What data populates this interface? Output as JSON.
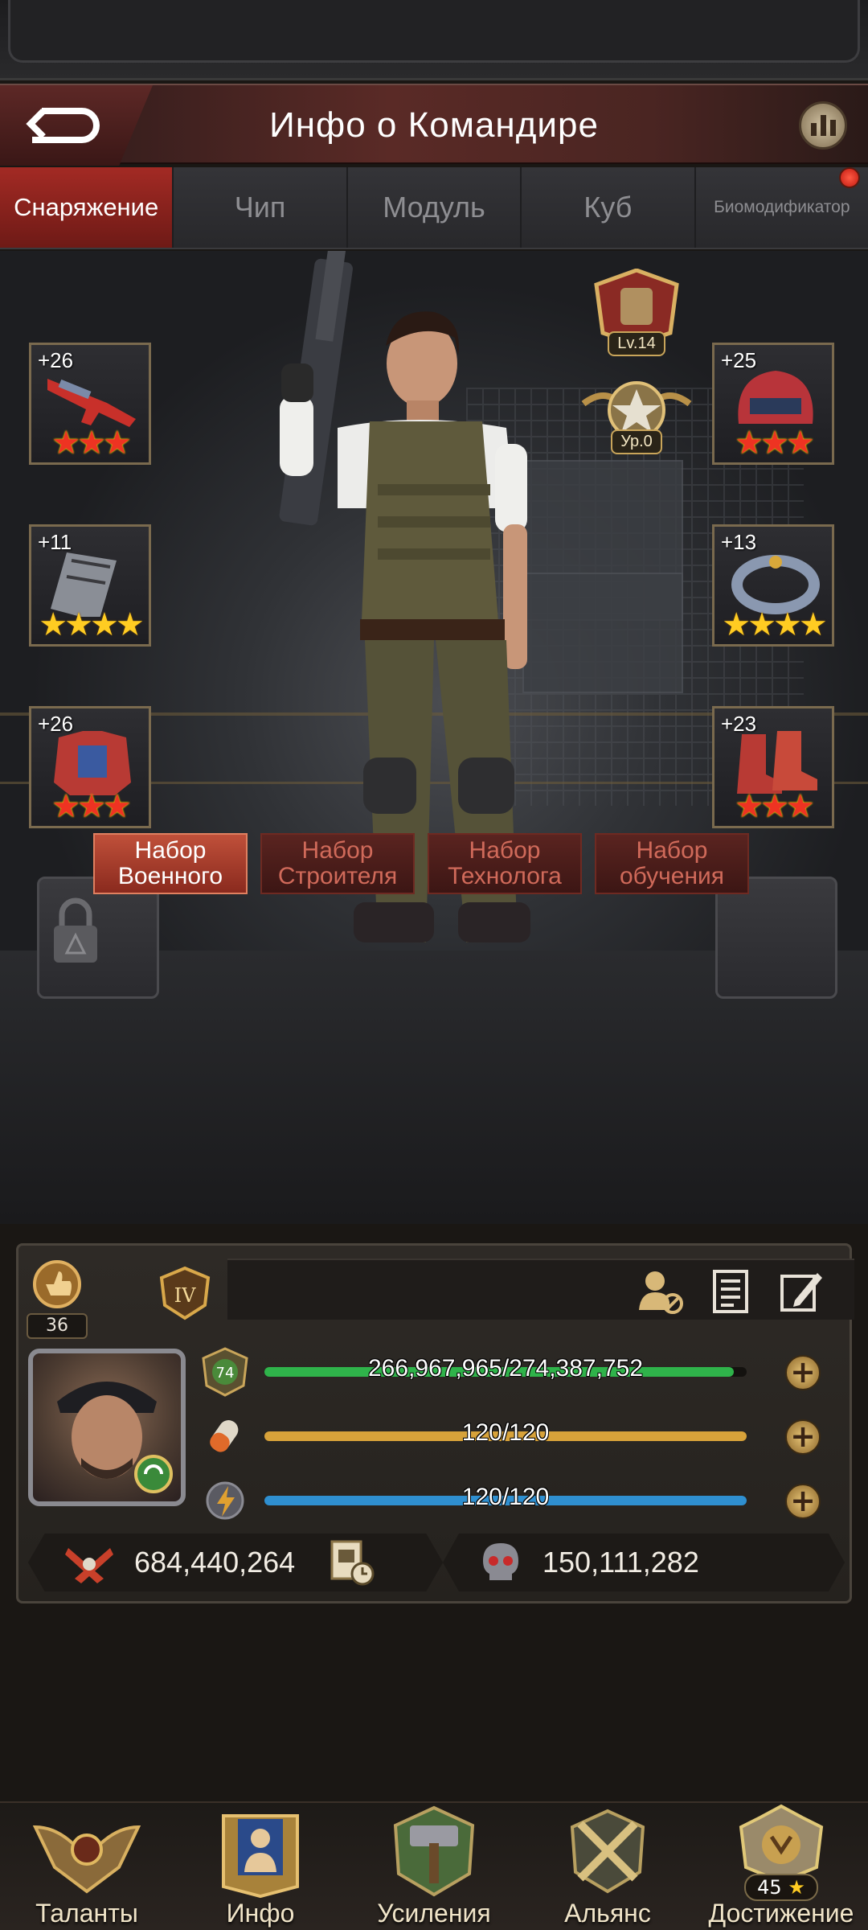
{
  "header": {
    "title": "Инфо о Командире"
  },
  "tabs": [
    {
      "label": "Снаряжение",
      "active": true
    },
    {
      "label": "Чип"
    },
    {
      "label": "Модуль"
    },
    {
      "label": "Куб"
    },
    {
      "label": "Биомодификатор",
      "has_notification": true
    }
  ],
  "equipment": {
    "left": [
      {
        "bonus": "+26",
        "stars": "★★★",
        "tier": "red",
        "icon": "rifle-icon"
      },
      {
        "bonus": "+11",
        "stars": "★★★★",
        "tier": "gold",
        "icon": "magazine-icon"
      },
      {
        "bonus": "+26",
        "stars": "★★★",
        "tier": "red",
        "icon": "armor-icon"
      }
    ],
    "right": [
      {
        "bonus": "+25",
        "stars": "★★★",
        "tier": "red",
        "icon": "helmet-icon"
      },
      {
        "bonus": "+13",
        "stars": "★★★★",
        "tier": "gold",
        "icon": "ring-icon"
      },
      {
        "bonus": "+23",
        "stars": "★★★",
        "tier": "red",
        "icon": "boots-icon"
      }
    ]
  },
  "badges": {
    "gear_level": "Lv.14",
    "rank_level": "Ур.0"
  },
  "kits": [
    {
      "label_1": "Набор",
      "label_2": "Военного",
      "active": true
    },
    {
      "label_1": "Набор",
      "label_2": "Строителя"
    },
    {
      "label_1": "Набор",
      "label_2": "Технолога"
    },
    {
      "label_1": "Набор",
      "label_2": "обучения"
    }
  ],
  "profile": {
    "likes": "36",
    "rank_badge": "IV",
    "level": "74",
    "experience": {
      "text": "266,967,965/274,387,752",
      "fraction": 0.973
    },
    "stamina": {
      "text": "120/120",
      "fraction": 1.0
    },
    "energy": {
      "text": "120/120",
      "fraction": 1.0
    },
    "power": "684,440,264",
    "kills": "150,111,282"
  },
  "colors": {
    "accent_red": "#a32a24",
    "exp_bar": "#2fb34a",
    "stamina_bar": "#d7a23a",
    "energy_bar": "#2f8fd0"
  },
  "nav": [
    {
      "label": "Таланты",
      "icon": "talents-icon"
    },
    {
      "label": "Инфо",
      "icon": "info-icon"
    },
    {
      "label": "Усиления",
      "icon": "boosts-icon"
    },
    {
      "label": "Альянс",
      "icon": "alliance-icon"
    },
    {
      "label": "Достижение",
      "icon": "achievement-icon",
      "count": "45"
    }
  ]
}
